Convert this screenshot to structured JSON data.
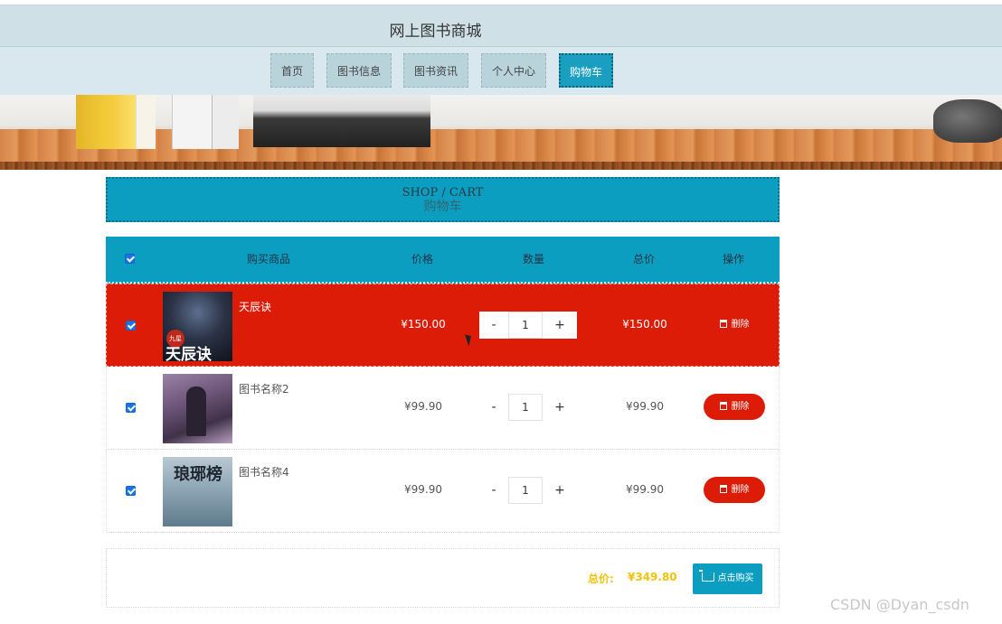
{
  "site": {
    "title": "网上图书商城"
  },
  "nav": [
    {
      "label": "首页"
    },
    {
      "label": "图书信息"
    },
    {
      "label": "图书资讯"
    },
    {
      "label": "个人中心"
    },
    {
      "label": "购物车",
      "active": true
    }
  ],
  "section": {
    "en": "SHOP / CART",
    "cn": "购物车"
  },
  "table": {
    "headers": [
      "购买商品",
      "价格",
      "数量",
      "总价",
      "操作"
    ],
    "rows": [
      {
        "name": "天辰诀",
        "price": "¥150.00",
        "qty": "1",
        "total": "¥150.00",
        "checked": true,
        "highlighted": true,
        "delete_label": "删除",
        "cover_text": "天辰诀",
        "cover_tag": "九星"
      },
      {
        "name": "图书名称2",
        "price": "¥99.90",
        "qty": "1",
        "total": "¥99.90",
        "checked": true,
        "highlighted": false,
        "delete_label": "删除"
      },
      {
        "name": "图书名称4",
        "price": "¥99.90",
        "qty": "1",
        "total": "¥99.90",
        "checked": true,
        "highlighted": false,
        "delete_label": "删除",
        "cover_text": "琅琊榜"
      }
    ]
  },
  "qty_controls": {
    "minus": "-",
    "plus": "+"
  },
  "summary": {
    "label": "总价:",
    "value": "¥349.80",
    "buy_label": "点击购买"
  },
  "watermark": "CSDN @Dyan_csdn",
  "colors": {
    "accent": "#0c9ec0",
    "highlight": "#dd1c08",
    "total": "#f2c20a"
  }
}
